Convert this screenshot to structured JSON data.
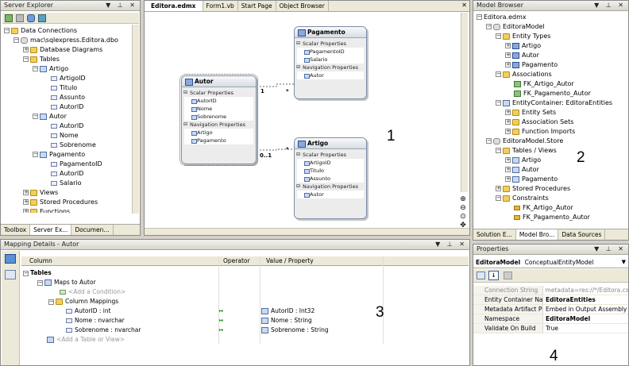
{
  "server_explorer": {
    "title": "Server Explorer",
    "title_buttons": "▼ ⊥ ✕",
    "tree": [
      {
        "label": "Data Connections",
        "depth": 0,
        "icon": "folder"
      },
      {
        "label": "mac\\sqlexpress.Editora.dbo",
        "depth": 1,
        "icon": "database"
      },
      {
        "label": "Database Diagrams",
        "depth": 2,
        "icon": "folder"
      },
      {
        "label": "Tables",
        "depth": 2,
        "icon": "folder"
      },
      {
        "label": "Artigo",
        "depth": 3,
        "icon": "table"
      },
      {
        "label": "ArtigoID",
        "depth": 4,
        "icon": "column"
      },
      {
        "label": "Titulo",
        "depth": 4,
        "icon": "column"
      },
      {
        "label": "Assunto",
        "depth": 4,
        "icon": "column"
      },
      {
        "label": "AutorID",
        "depth": 4,
        "icon": "column"
      },
      {
        "label": "Autor",
        "depth": 3,
        "icon": "table"
      },
      {
        "label": "AutorID",
        "depth": 4,
        "icon": "column"
      },
      {
        "label": "Nome",
        "depth": 4,
        "icon": "column"
      },
      {
        "label": "Sobrenome",
        "depth": 4,
        "icon": "column"
      },
      {
        "label": "Pagamento",
        "depth": 3,
        "icon": "table"
      },
      {
        "label": "PagamentoID",
        "depth": 4,
        "icon": "column"
      },
      {
        "label": "AutorID",
        "depth": 4,
        "icon": "column"
      },
      {
        "label": "Salario",
        "depth": 4,
        "icon": "column"
      },
      {
        "label": "Views",
        "depth": 2,
        "icon": "folder"
      },
      {
        "label": "Stored Procedures",
        "depth": 2,
        "icon": "folder"
      },
      {
        "label": "Functions",
        "depth": 2,
        "icon": "folder"
      }
    ],
    "tabs": [
      "Toolbox",
      "Server Ex...",
      "Documen..."
    ]
  },
  "editor": {
    "tabs": [
      "Editora.edmx",
      "Form1.vb",
      "Start Page",
      "Object Browser"
    ],
    "close_glyph": "✕",
    "entities": {
      "autor": {
        "name": "Autor",
        "scalar_header": "Scalar Properties",
        "scalar": [
          "AutorID",
          "Nome",
          "Sobrenome"
        ],
        "nav_header": "Navigation Properties",
        "nav": [
          "Artigo",
          "Pagamento"
        ]
      },
      "pagamento": {
        "name": "Pagamento",
        "scalar_header": "Scalar Properties",
        "scalar": [
          "PagamentoID",
          "Salario"
        ],
        "nav_header": "Navigation Properties",
        "nav": [
          "Autor"
        ]
      },
      "artigo": {
        "name": "Artigo",
        "scalar_header": "Scalar Properties",
        "scalar": [
          "ArtigoID",
          "Titulo",
          "Assunto"
        ],
        "nav_header": "Navigation Properties",
        "nav": [
          "Autor"
        ]
      }
    },
    "multiplicity": {
      "autor_pag": "1",
      "pag_end": "*",
      "autor_art": "0..1",
      "art_end": "*"
    },
    "zoom_icons": [
      "⊕",
      "⊖",
      "⊙",
      "✥"
    ],
    "annotation": "1"
  },
  "model_browser": {
    "title": "Model Browser",
    "title_buttons": "▼ ⊥ ✕",
    "tree": [
      {
        "label": "Editora.edmx",
        "depth": 0,
        "icon": "none"
      },
      {
        "label": "EditoraModel",
        "depth": 1,
        "icon": "database"
      },
      {
        "label": "Entity Types",
        "depth": 2,
        "icon": "folder"
      },
      {
        "label": "Artigo",
        "depth": 3,
        "icon": "entity"
      },
      {
        "label": "Autor",
        "depth": 3,
        "icon": "entity"
      },
      {
        "label": "Pagamento",
        "depth": 3,
        "icon": "entity"
      },
      {
        "label": "Associations",
        "depth": 2,
        "icon": "folder"
      },
      {
        "label": "FK_Artigo_Autor",
        "depth": 3,
        "icon": "association"
      },
      {
        "label": "FK_Pagamento_Autor",
        "depth": 3,
        "icon": "association"
      },
      {
        "label": "EntityContainer: EditoraEntities",
        "depth": 2,
        "icon": "table"
      },
      {
        "label": "Entity Sets",
        "depth": 3,
        "icon": "folder"
      },
      {
        "label": "Association Sets",
        "depth": 3,
        "icon": "folder"
      },
      {
        "label": "Function Imports",
        "depth": 3,
        "icon": "folder"
      },
      {
        "label": "EditoraModel.Store",
        "depth": 1,
        "icon": "database"
      },
      {
        "label": "Tables / Views",
        "depth": 2,
        "icon": "folder"
      },
      {
        "label": "Artigo",
        "depth": 3,
        "icon": "table"
      },
      {
        "label": "Autor",
        "depth": 3,
        "icon": "table"
      },
      {
        "label": "Pagamento",
        "depth": 3,
        "icon": "table"
      },
      {
        "label": "Stored Procedures",
        "depth": 2,
        "icon": "folder"
      },
      {
        "label": "Constraints",
        "depth": 2,
        "icon": "folder"
      },
      {
        "label": "FK_Artigo_Autor",
        "depth": 3,
        "icon": "key"
      },
      {
        "label": "FK_Pagamento_Autor",
        "depth": 3,
        "icon": "key"
      }
    ],
    "tabs": [
      "Solution E...",
      "Model Bro...",
      "Data Sources"
    ],
    "annotation": "2"
  },
  "mapping": {
    "title": "Mapping Details - Autor",
    "title_buttons": "▼ ⊥ ✕",
    "headers": [
      "Column",
      "Operator",
      "Value / Property"
    ],
    "tables_label": "Tables",
    "maps_to": "Maps to Autor",
    "add_condition": "<Add a Condition>",
    "column_mappings": "Column Mappings",
    "rows": [
      {
        "column": "AutorID : int",
        "operator": "↔",
        "value": "AutorID : Int32"
      },
      {
        "column": "Nome : nvarchar",
        "operator": "↔",
        "value": "Nome : String"
      },
      {
        "column": "Sobrenome : nvarchar",
        "operator": "↔",
        "value": "Sobrenome : String"
      }
    ],
    "add_table": "<Add a Table or View>",
    "annotation": "3"
  },
  "properties": {
    "title": "Properties",
    "title_buttons": "▼ ⊥ ✕",
    "object_name": "EditoraModel",
    "object_type": "ConceptualEntityModel",
    "rows": [
      {
        "key": "Connection String",
        "value": "metadata=res://*/Editora.cs",
        "dim": true
      },
      {
        "key": "Entity Container Name",
        "value": "EditoraEntities",
        "bold": true
      },
      {
        "key": "Metadata Artifact Proc",
        "value": "Embed in Output Assembly"
      },
      {
        "key": "Namespace",
        "value": "EditoraModel",
        "bold": true
      },
      {
        "key": "Validate On Build",
        "value": "True"
      }
    ],
    "annotation": "4"
  }
}
